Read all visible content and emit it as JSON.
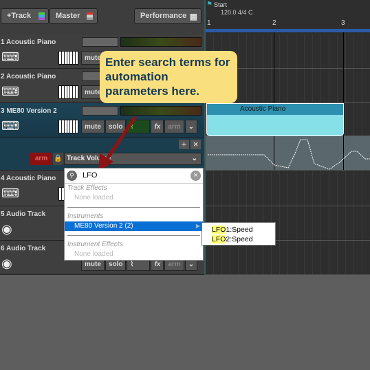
{
  "toolbar": {
    "add_track": "+Track",
    "master": "Master",
    "performance": "Performance"
  },
  "tracks": [
    {
      "name": "1 Acoustic Piano",
      "type": "instrument"
    },
    {
      "name": "2 Acoustic Piano",
      "type": "instrument"
    },
    {
      "name": "3 ME80 Version 2",
      "type": "instrument",
      "selected": true
    },
    {
      "name": "4 Acoustic Piano",
      "type": "instrument"
    },
    {
      "name": "5 Audio Track",
      "type": "audio"
    },
    {
      "name": "6 Audio Track",
      "type": "audio"
    }
  ],
  "track_buttons": {
    "mute": "mute",
    "solo": "solo",
    "fx": "fx",
    "arm": "arm"
  },
  "automation": {
    "arm": "arm",
    "parameter": "Track Volume",
    "add": "+",
    "close": "×"
  },
  "search": {
    "value": "LFO"
  },
  "dropdown": {
    "track_effects": "Track Effects",
    "track_effects_none": "None loaded",
    "instruments": "Instruments",
    "instrument_item": "ME80 Version 2 (2)",
    "instrument_effects": "Instrument Effects",
    "instrument_effects_none": "None loaded"
  },
  "submenu": [
    {
      "match": "LFO",
      "rest": "1:Speed"
    },
    {
      "match": "LFO",
      "rest": "2:Speed"
    }
  ],
  "timeline": {
    "marker": "Start",
    "tempo": "120.0 4/4 C",
    "bars": [
      "1",
      "2",
      "3"
    ]
  },
  "clip": {
    "name": "Acoustic Piano"
  },
  "tooltip": "Enter search terms for automation parameters here.",
  "colors": {
    "selected_track": "#1c4456",
    "tooltip": "#f9df7e",
    "clip": "#86e0e8",
    "highlight": "#0a6fd4",
    "arm": "#8c1010"
  }
}
